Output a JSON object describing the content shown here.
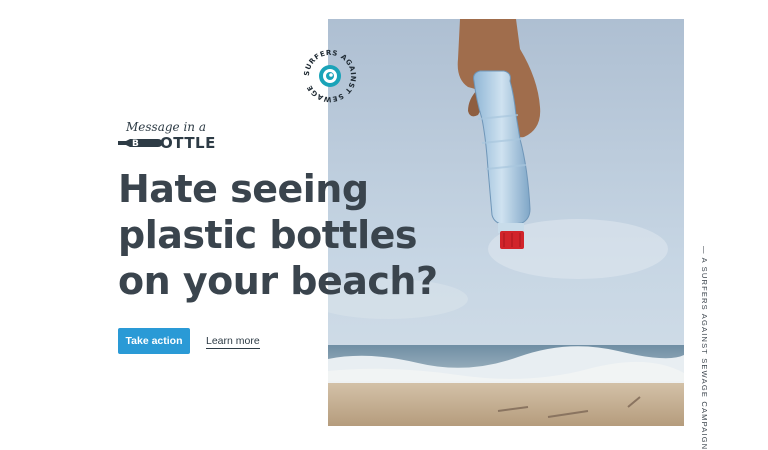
{
  "brand": {
    "script_line": "Message in a",
    "word": "OTTLE"
  },
  "badge": {
    "text": "SURFERS AGAINST SEWAGE",
    "icon": "wave-swirl-icon"
  },
  "hero": {
    "headline_lines": [
      "Hate seeing",
      "plastic bottles",
      "on your beach?"
    ],
    "photo": "hand-holding-plastic-bottle-on-beach"
  },
  "actions": {
    "primary_label": "Take action",
    "secondary_label": "Learn more"
  },
  "side_tag": "— A SURFERS AGAINST SEWAGE CAMPAIGN",
  "colors": {
    "accent": "#2a9ad6",
    "text": "#3a444d",
    "sky": "#b9cbdc",
    "sand": "#c7b39a",
    "cap": "#d1242b"
  }
}
